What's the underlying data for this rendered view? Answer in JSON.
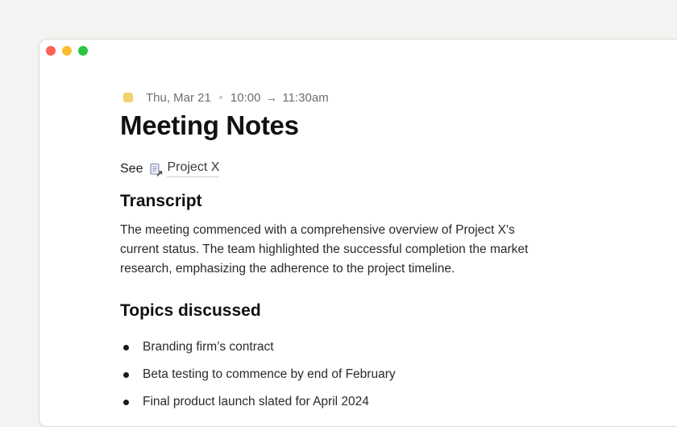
{
  "event": {
    "calendar_color": "#f2d26b",
    "date": "Thu, Mar 21",
    "start_time": "10:00",
    "arrow": "→",
    "end_time": "11:30am"
  },
  "note": {
    "title": "Meeting Notes",
    "see_prefix": "See",
    "linked_page": "Project X",
    "sections": {
      "transcript_heading": "Transcript",
      "transcript_text": "The meeting commenced with a comprehensive overview of Project X's current status. The team highlighted the successful completion the market research, emphasizing the adherence to the project timeline.",
      "topics_heading": "Topics discussed",
      "topics": [
        "Branding firm’s contract",
        "Beta testing to commence by end of February",
        "Final product launch slated for April 2024"
      ]
    }
  },
  "window_controls": {
    "close_color": "#fe5f57",
    "minimize_color": "#febc2e",
    "maximize_color": "#28c840"
  }
}
